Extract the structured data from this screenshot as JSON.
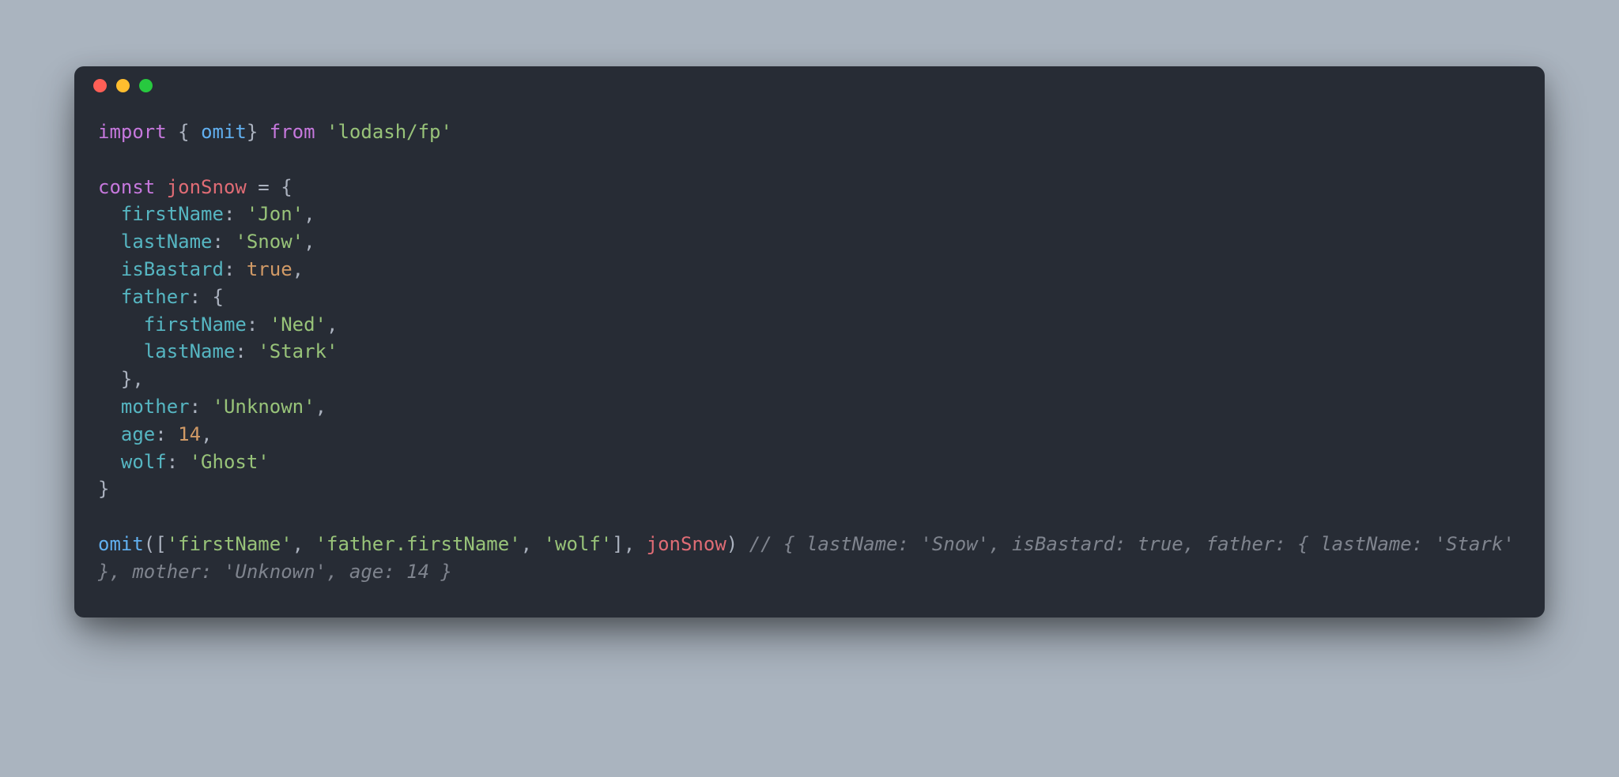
{
  "window": {
    "traffic_light_colors": {
      "close": "#ff5f56",
      "minimize": "#ffbd2e",
      "zoom": "#27c93f"
    }
  },
  "code": {
    "l1": {
      "import_kw": "import",
      "brace_o": " { ",
      "omit": "omit",
      "brace_c": "} ",
      "from_kw": "from ",
      "module": "'lodash/fp'"
    },
    "l2": "",
    "l3": {
      "const_kw": "const ",
      "var": "jonSnow",
      "eq": " = {"
    },
    "l4": {
      "indent": "  ",
      "key": "firstName",
      "colon": ": ",
      "val": "'Jon'",
      "comma": ","
    },
    "l5": {
      "indent": "  ",
      "key": "lastName",
      "colon": ": ",
      "val": "'Snow'",
      "comma": ","
    },
    "l6": {
      "indent": "  ",
      "key": "isBastard",
      "colon": ": ",
      "val": "true",
      "comma": ","
    },
    "l7": {
      "indent": "  ",
      "key": "father",
      "colon": ": {",
      "comma": ""
    },
    "l8": {
      "indent": "    ",
      "key": "firstName",
      "colon": ": ",
      "val": "'Ned'",
      "comma": ","
    },
    "l9": {
      "indent": "    ",
      "key": "lastName",
      "colon": ": ",
      "val": "'Stark'",
      "comma": ""
    },
    "l10": {
      "indent": "  ",
      "close": "},"
    },
    "l11": {
      "indent": "  ",
      "key": "mother",
      "colon": ": ",
      "val": "'Unknown'",
      "comma": ","
    },
    "l12": {
      "indent": "  ",
      "key": "age",
      "colon": ": ",
      "val": "14",
      "comma": ","
    },
    "l13": {
      "indent": "  ",
      "key": "wolf",
      "colon": ": ",
      "val": "'Ghost'",
      "comma": ""
    },
    "l14": {
      "close": "}"
    },
    "l15": "",
    "l16": {
      "fn": "omit",
      "open": "([",
      "a1": "'firstName'",
      "c1": ", ",
      "a2": "'father.firstName'",
      "c2": ", ",
      "a3": "'wolf'",
      "close_arr": "], ",
      "var": "jonSnow",
      "close_call": ") ",
      "comment": "// { lastName: 'Snow', isBastard: true, father: { lastName: 'Stark' }, mother: 'Unknown', age: 14 }"
    }
  }
}
